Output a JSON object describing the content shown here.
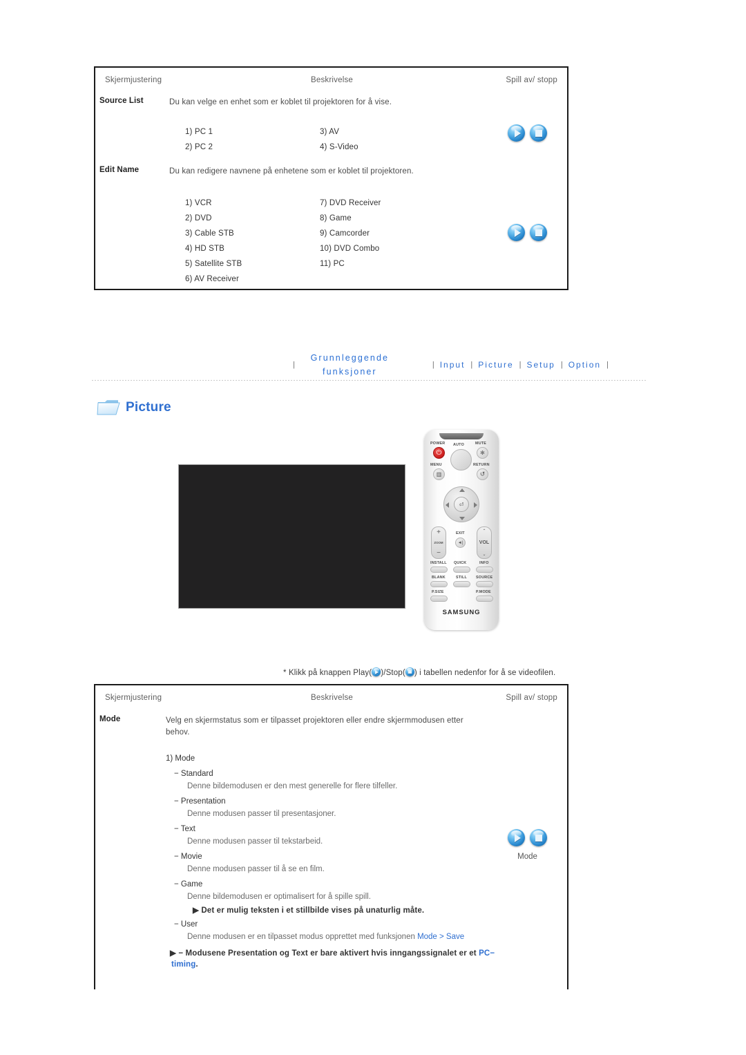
{
  "table_top": {
    "headers": {
      "col_a": "Skjermjustering",
      "col_b": "Beskrivelse",
      "col_c": "Spill av/ stopp"
    },
    "rows": [
      {
        "label": "Source List",
        "description": "Du kan velge en enhet som er koblet til projektoren for å vise.",
        "items_left": [
          "1) PC 1",
          "2) PC 2"
        ],
        "items_right": [
          "3) AV",
          "4) S-Video"
        ]
      },
      {
        "label": "Edit Name",
        "description": "Du kan redigere navnene på enhetene som er koblet til projektoren.",
        "items_left": [
          "1) VCR",
          "2) DVD",
          "3) Cable STB",
          "4) HD STB",
          "5) Satellite STB",
          "6) AV Receiver"
        ],
        "items_right": [
          "7) DVD Receiver",
          "8) Game",
          "9) Camcorder",
          "10) DVD Combo",
          "11) PC"
        ]
      }
    ]
  },
  "nav": {
    "pipe": "|",
    "current_line1": "Grunnleggende",
    "current_line2": "funksjoner",
    "links": [
      "Input",
      "Picture",
      "Setup",
      "Option"
    ],
    "separator": "|",
    "accent_color": "#2f6fd0"
  },
  "section": {
    "icon": "folder-icon",
    "title": "Picture"
  },
  "remote": {
    "labels": {
      "power": "POWER",
      "auto": "AUTO",
      "mute": "MUTE",
      "menu": "MENU",
      "return": "RETURN",
      "exit": "EXIT",
      "vol": "VOL",
      "install": "INSTALL",
      "quick": "QUICK",
      "info": "INFO",
      "blank": "BLANK",
      "still": "STILL",
      "source": "SOURCE",
      "psize": "P.SIZE",
      "pmode": "P.MODE",
      "brand": "SAMSUNG",
      "plus": "+",
      "minus": "−",
      "zoom": "ZOOM",
      "up": "▲",
      "down": "▼",
      "left": "◄",
      "right": "►",
      "enter": "⏎",
      "power_glyph": "⏻",
      "mute_glyph": "✻",
      "menu_glyph": "▥",
      "return_glyph": "↺",
      "exit_glyph": "◄|",
      "vol_up_glyph": "⌃",
      "vol_down_glyph": "⌄"
    }
  },
  "caption": {
    "prefix": "* Klikk på knappen Play(",
    "mid": ")/Stop(",
    "suffix": ") i tabellen nedenfor for å se videofilen."
  },
  "table_bottom": {
    "headers": {
      "col_a": "Skjermjustering",
      "col_b": "Beskrivelse",
      "col_c": "Spill av/ stopp"
    },
    "row_label": "Mode",
    "description_line1": "Velg en skjermstatus som er tilpasset projektoren eller endre skjermmodusen etter",
    "description_line2": "behov.",
    "list_heading": "1) Mode",
    "modes": [
      {
        "name": "− Standard",
        "desc": "Denne bildemodusen er den mest generelle for flere tilfeller."
      },
      {
        "name": "− Presentation",
        "desc": "Denne modusen passer til presentasjoner."
      },
      {
        "name": "− Text",
        "desc": "Denne modusen passer til tekstarbeid."
      },
      {
        "name": "− Movie",
        "desc": "Denne modusen passer til å se en film."
      },
      {
        "name": "− Game",
        "desc": "Denne bildemodusen er optimalisert for å spille spill."
      }
    ],
    "game_note": "▶ Det er mulig teksten i et stillbilde vises på unaturlig måte.",
    "user_name": "− User",
    "user_desc_plain": "Denne modusen er en tilpasset modus opprettet med funksjonen ",
    "user_desc_link": "Mode > Save",
    "footnote_line1_plain": "▶ − Modusene Presentation og Text er bare aktivert hvis inngangssignalet er et ",
    "footnote_line1_link": "PC−",
    "footnote_line2_link": "timing",
    "footnote_line2_plain": ".",
    "play_caption": "Mode"
  },
  "icons": {
    "play": "play-icon",
    "stop": "stop-icon"
  }
}
